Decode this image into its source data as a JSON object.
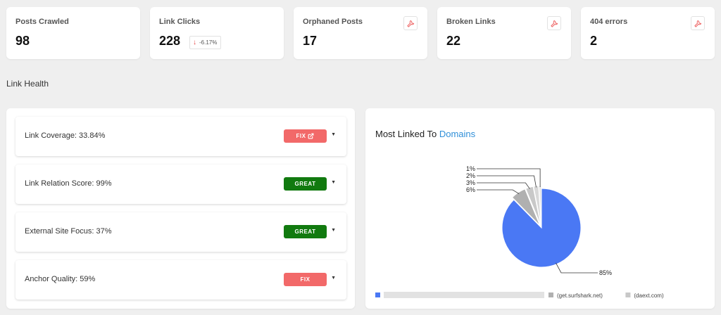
{
  "stats": [
    {
      "label": "Posts Crawled",
      "value": "98"
    },
    {
      "label": "Link Clicks",
      "value": "228",
      "trend": "-6.17%",
      "trend_direction": "down"
    },
    {
      "label": "Orphaned Posts",
      "value": "17",
      "icon": "wrench-icon"
    },
    {
      "label": "Broken Links",
      "value": "22",
      "icon": "wrench-icon"
    },
    {
      "label": "404 errors",
      "value": "2",
      "icon": "wrench-icon"
    }
  ],
  "section_title": "Link Health",
  "health": [
    {
      "label": "Link Coverage: 33.84%",
      "badge": "FIX",
      "badge_icon": "external-link-icon",
      "status": "fix"
    },
    {
      "label": "Link Relation Score: 99%",
      "badge": "GREAT",
      "status": "great"
    },
    {
      "label": "External Site Focus: 37%",
      "badge": "GREAT",
      "status": "great"
    },
    {
      "label": "Anchor Quality: 59%",
      "badge": "FIX",
      "status": "fix"
    }
  ],
  "chart": {
    "title": "Most Linked To",
    "title_accent": "Domains"
  },
  "chart_data": {
    "type": "pie",
    "slices": [
      {
        "label": "",
        "value": 85,
        "display": "85%",
        "color": "#4a78f4",
        "legend_obscured": true
      },
      {
        "label": "(get.surfshark.net)",
        "value": 6,
        "display": "6%",
        "color": "#b0b0b0"
      },
      {
        "label": "(daext.com)",
        "value": 3,
        "display": "3%",
        "color": "#c8c8c8"
      },
      {
        "label": "",
        "value": 2,
        "display": "2%",
        "color": "#d8d8d8"
      },
      {
        "label": "",
        "value": 1,
        "display": "1%",
        "color": "#e4e4e4"
      }
    ],
    "legend": "bottom"
  },
  "colors": {
    "background": "#efefef",
    "fix": "#f26969",
    "great": "#117a0f",
    "pie_primary": "#4a78f4",
    "accent_link": "#2f8fd8"
  }
}
